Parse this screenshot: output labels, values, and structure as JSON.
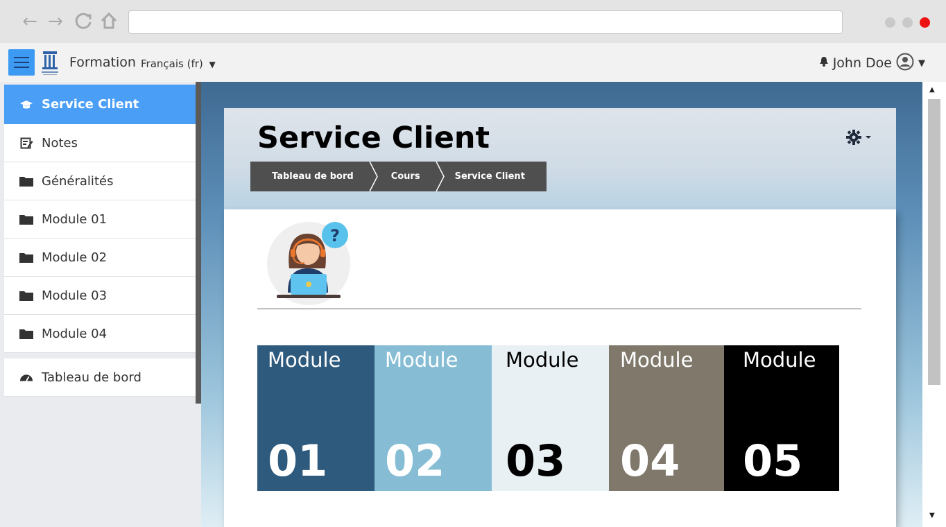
{
  "browser": {
    "url": ""
  },
  "navbar": {
    "brand": "Formation",
    "language": "Français (fr)",
    "user_name": "John Doe"
  },
  "sidebar": {
    "items": [
      {
        "label": "Service Client",
        "icon": "graduation-cap-icon"
      },
      {
        "label": "Notes",
        "icon": "notes-icon"
      },
      {
        "label": "Généralités",
        "icon": "folder-icon"
      },
      {
        "label": "Module 01",
        "icon": "folder-icon"
      },
      {
        "label": "Module 02",
        "icon": "folder-icon"
      },
      {
        "label": "Module 03",
        "icon": "folder-icon"
      },
      {
        "label": "Module 04",
        "icon": "folder-icon"
      },
      {
        "label": "Tableau de bord",
        "icon": "dashboard-icon"
      }
    ]
  },
  "page": {
    "title": "Service Client",
    "breadcrumb": [
      "Tableau de bord",
      "Cours",
      "Service Client"
    ]
  },
  "modules": [
    {
      "word": "Module",
      "number": "01",
      "bg": "#2e5a7e",
      "fg": "#ffffff"
    },
    {
      "word": "Module",
      "number": "02",
      "bg": "#86bdd5",
      "fg": "#ffffff"
    },
    {
      "word": "Module",
      "number": "03",
      "bg": "#e9f0f4",
      "fg": "#000000"
    },
    {
      "word": "Module",
      "number": "04",
      "bg": "#7f786b",
      "fg": "#ffffff"
    },
    {
      "word": "Module",
      "number": "05",
      "bg": "#000000",
      "fg": "#ffffff"
    }
  ],
  "colors": {
    "accent": "#4a9ef5",
    "window_red": "#ee1111"
  }
}
